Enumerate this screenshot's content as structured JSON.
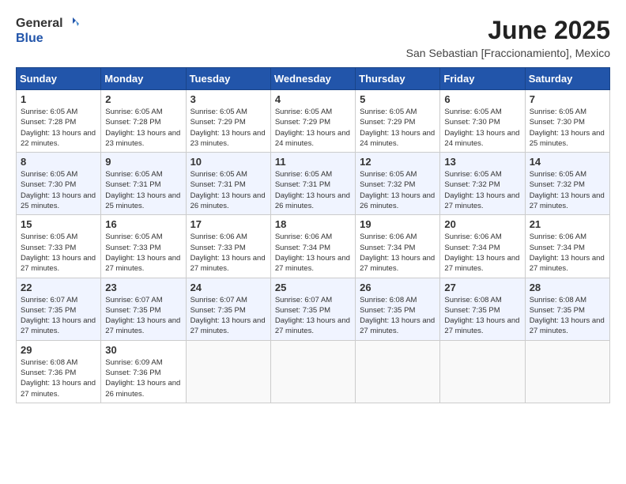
{
  "logo": {
    "general": "General",
    "blue": "Blue"
  },
  "title": "June 2025",
  "subtitle": "San Sebastian [Fraccionamiento], Mexico",
  "days_header": [
    "Sunday",
    "Monday",
    "Tuesday",
    "Wednesday",
    "Thursday",
    "Friday",
    "Saturday"
  ],
  "weeks": [
    [
      {
        "day": "1",
        "sunrise": "6:05 AM",
        "sunset": "7:28 PM",
        "daylight": "13 hours and 22 minutes."
      },
      {
        "day": "2",
        "sunrise": "6:05 AM",
        "sunset": "7:28 PM",
        "daylight": "13 hours and 23 minutes."
      },
      {
        "day": "3",
        "sunrise": "6:05 AM",
        "sunset": "7:29 PM",
        "daylight": "13 hours and 23 minutes."
      },
      {
        "day": "4",
        "sunrise": "6:05 AM",
        "sunset": "7:29 PM",
        "daylight": "13 hours and 24 minutes."
      },
      {
        "day": "5",
        "sunrise": "6:05 AM",
        "sunset": "7:29 PM",
        "daylight": "13 hours and 24 minutes."
      },
      {
        "day": "6",
        "sunrise": "6:05 AM",
        "sunset": "7:30 PM",
        "daylight": "13 hours and 24 minutes."
      },
      {
        "day": "7",
        "sunrise": "6:05 AM",
        "sunset": "7:30 PM",
        "daylight": "13 hours and 25 minutes."
      }
    ],
    [
      {
        "day": "8",
        "sunrise": "6:05 AM",
        "sunset": "7:30 PM",
        "daylight": "13 hours and 25 minutes."
      },
      {
        "day": "9",
        "sunrise": "6:05 AM",
        "sunset": "7:31 PM",
        "daylight": "13 hours and 25 minutes."
      },
      {
        "day": "10",
        "sunrise": "6:05 AM",
        "sunset": "7:31 PM",
        "daylight": "13 hours and 26 minutes."
      },
      {
        "day": "11",
        "sunrise": "6:05 AM",
        "sunset": "7:31 PM",
        "daylight": "13 hours and 26 minutes."
      },
      {
        "day": "12",
        "sunrise": "6:05 AM",
        "sunset": "7:32 PM",
        "daylight": "13 hours and 26 minutes."
      },
      {
        "day": "13",
        "sunrise": "6:05 AM",
        "sunset": "7:32 PM",
        "daylight": "13 hours and 27 minutes."
      },
      {
        "day": "14",
        "sunrise": "6:05 AM",
        "sunset": "7:32 PM",
        "daylight": "13 hours and 27 minutes."
      }
    ],
    [
      {
        "day": "15",
        "sunrise": "6:05 AM",
        "sunset": "7:33 PM",
        "daylight": "13 hours and 27 minutes."
      },
      {
        "day": "16",
        "sunrise": "6:05 AM",
        "sunset": "7:33 PM",
        "daylight": "13 hours and 27 minutes."
      },
      {
        "day": "17",
        "sunrise": "6:06 AM",
        "sunset": "7:33 PM",
        "daylight": "13 hours and 27 minutes."
      },
      {
        "day": "18",
        "sunrise": "6:06 AM",
        "sunset": "7:34 PM",
        "daylight": "13 hours and 27 minutes."
      },
      {
        "day": "19",
        "sunrise": "6:06 AM",
        "sunset": "7:34 PM",
        "daylight": "13 hours and 27 minutes."
      },
      {
        "day": "20",
        "sunrise": "6:06 AM",
        "sunset": "7:34 PM",
        "daylight": "13 hours and 27 minutes."
      },
      {
        "day": "21",
        "sunrise": "6:06 AM",
        "sunset": "7:34 PM",
        "daylight": "13 hours and 27 minutes."
      }
    ],
    [
      {
        "day": "22",
        "sunrise": "6:07 AM",
        "sunset": "7:35 PM",
        "daylight": "13 hours and 27 minutes."
      },
      {
        "day": "23",
        "sunrise": "6:07 AM",
        "sunset": "7:35 PM",
        "daylight": "13 hours and 27 minutes."
      },
      {
        "day": "24",
        "sunrise": "6:07 AM",
        "sunset": "7:35 PM",
        "daylight": "13 hours and 27 minutes."
      },
      {
        "day": "25",
        "sunrise": "6:07 AM",
        "sunset": "7:35 PM",
        "daylight": "13 hours and 27 minutes."
      },
      {
        "day": "26",
        "sunrise": "6:08 AM",
        "sunset": "7:35 PM",
        "daylight": "13 hours and 27 minutes."
      },
      {
        "day": "27",
        "sunrise": "6:08 AM",
        "sunset": "7:35 PM",
        "daylight": "13 hours and 27 minutes."
      },
      {
        "day": "28",
        "sunrise": "6:08 AM",
        "sunset": "7:35 PM",
        "daylight": "13 hours and 27 minutes."
      }
    ],
    [
      {
        "day": "29",
        "sunrise": "6:08 AM",
        "sunset": "7:36 PM",
        "daylight": "13 hours and 27 minutes."
      },
      {
        "day": "30",
        "sunrise": "6:09 AM",
        "sunset": "7:36 PM",
        "daylight": "13 hours and 26 minutes."
      },
      null,
      null,
      null,
      null,
      null
    ]
  ]
}
